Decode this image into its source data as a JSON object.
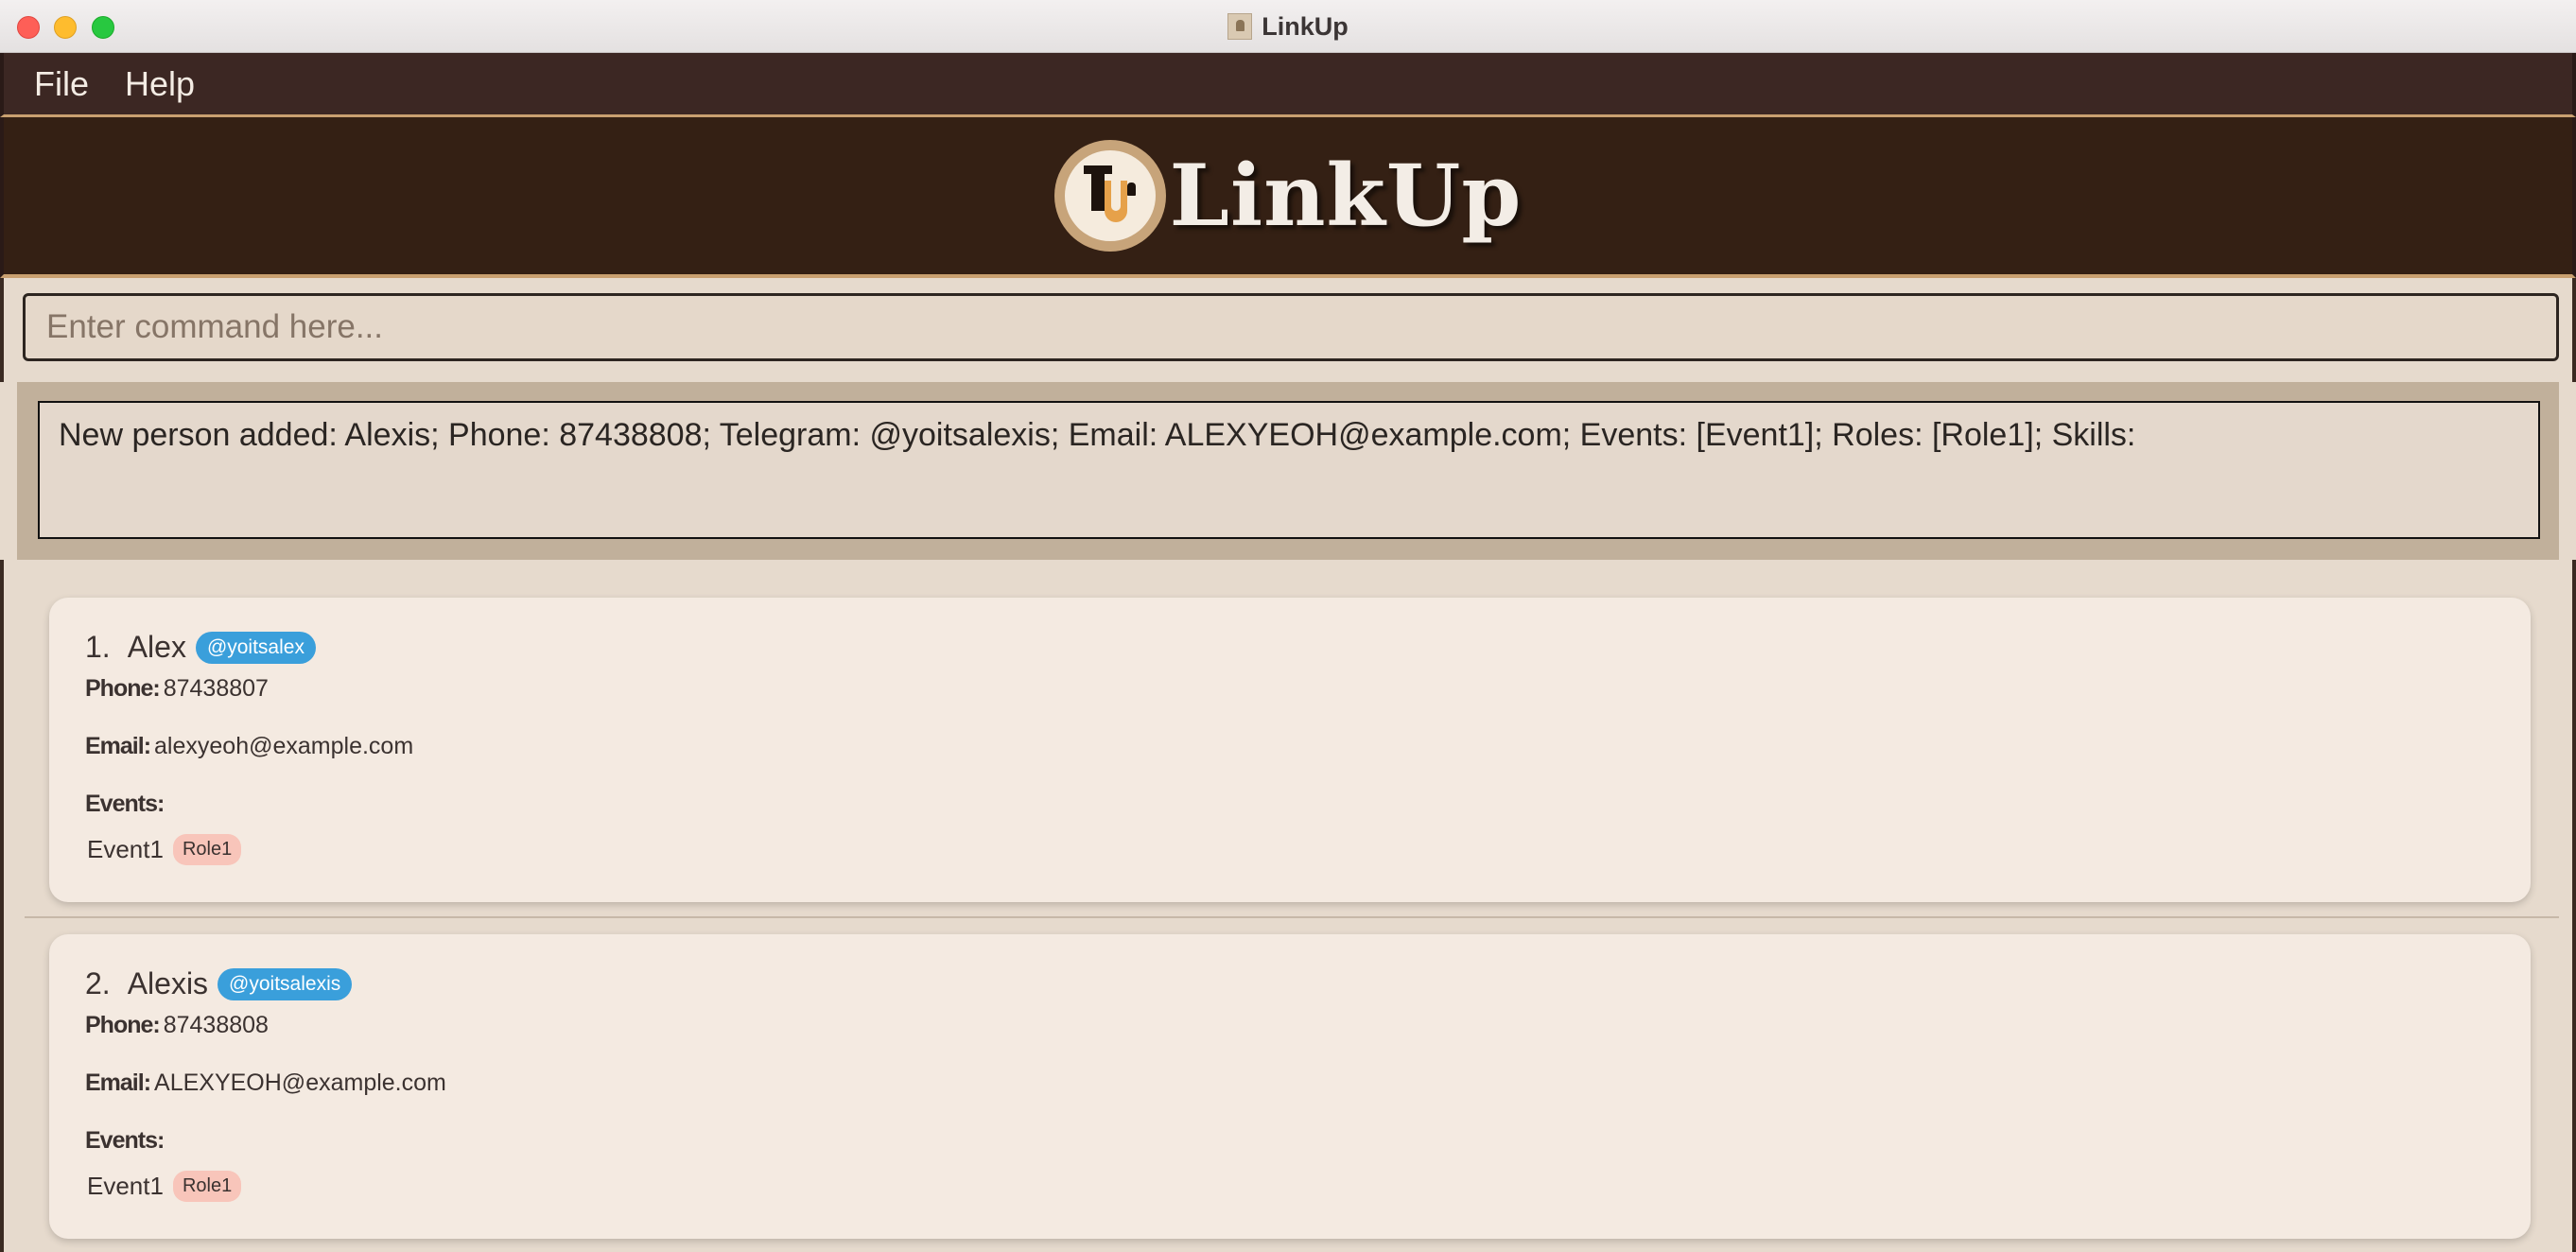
{
  "window": {
    "title": "LinkUp"
  },
  "menu": {
    "items": [
      "File",
      "Help"
    ]
  },
  "banner": {
    "logo_text": "LinkUp"
  },
  "command": {
    "placeholder": "Enter command here...",
    "value": ""
  },
  "result": {
    "text": "New person added: Alexis; Phone: 87438808; Telegram: @yoitsalexis; Email: ALEXYEOH@example.com; Events: [Event1]; Roles: [Role1]; Skills:"
  },
  "labels": {
    "phone": "Phone:",
    "email": "Email:",
    "events": "Events:"
  },
  "persons": [
    {
      "index": "1.",
      "name": "Alex",
      "telegram": "@yoitsalex",
      "phone": "87438807",
      "email": "alexyeoh@example.com",
      "event": "Event1",
      "role": "Role1"
    },
    {
      "index": "2.",
      "name": "Alexis",
      "telegram": "@yoitsalexis",
      "phone": "87438808",
      "email": "ALEXYEOH@example.com",
      "event": "Event1",
      "role": "Role1"
    }
  ],
  "colors": {
    "menubar": "#3c2723",
    "banner": "#342014",
    "accent": "#c9a070",
    "telegram_badge": "#3a9fdb",
    "role_badge": "#f8c5ba"
  }
}
